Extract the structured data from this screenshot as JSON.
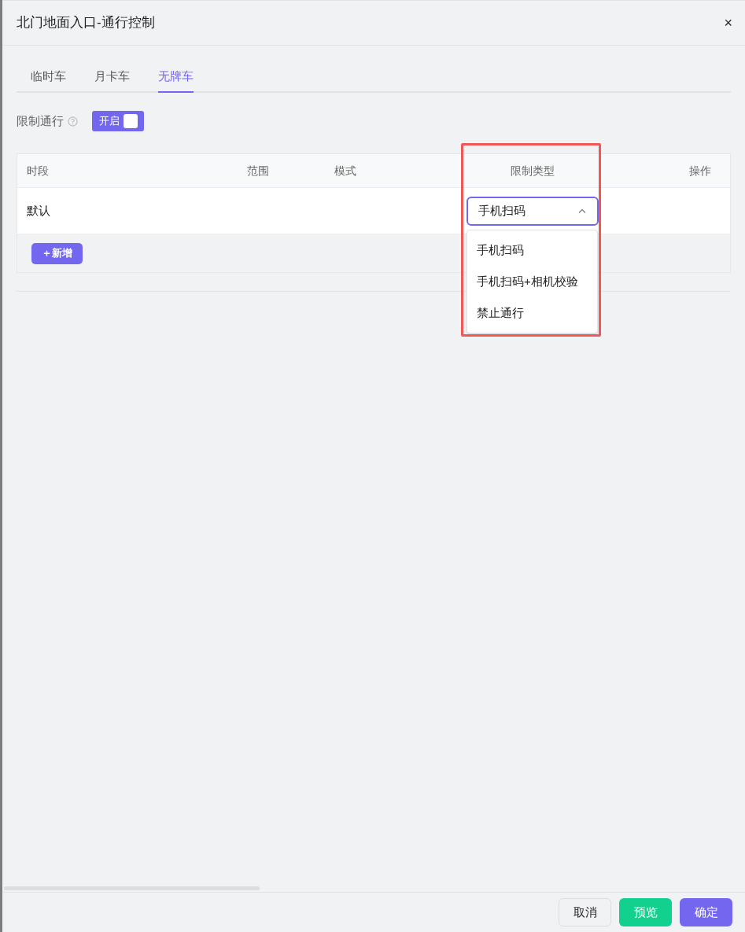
{
  "dialog": {
    "title": "北门地面入口-通行控制",
    "close": "×"
  },
  "tabs": [
    {
      "label": "临时车",
      "selected": false
    },
    {
      "label": "月卡车",
      "selected": false
    },
    {
      "label": "无牌车",
      "selected": true
    }
  ],
  "restriction": {
    "label": "限制通行",
    "toggle_text": "开启",
    "on": true
  },
  "table": {
    "columns": [
      "时段",
      "范围",
      "模式",
      "限制类型",
      "操作"
    ],
    "rows": [
      {
        "period": "默认",
        "limit_type": "手机扫码",
        "expanded": true
      }
    ],
    "add_button": "＋新增"
  },
  "dropdown_options": [
    "手机扫码",
    "手机扫码+相机校验",
    "禁止通行"
  ],
  "buttons": [
    {
      "label": "取消",
      "kind": "default"
    },
    {
      "label": "预览",
      "kind": "success"
    },
    {
      "label": "确定",
      "kind": "primary"
    }
  ]
}
